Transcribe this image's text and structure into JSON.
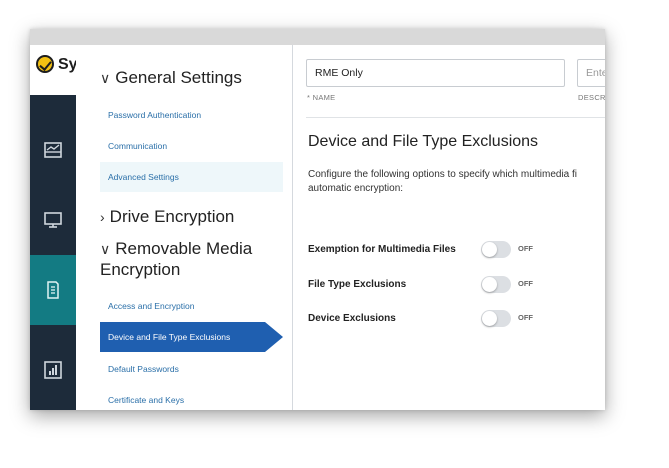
{
  "app": {
    "logo_text": "Sy"
  },
  "rail": {
    "items": [
      "dashboard-icon",
      "devices-icon",
      "policies-icon",
      "reports-icon"
    ],
    "active_index": 2
  },
  "nav": {
    "general_settings": "General Settings",
    "general_items": [
      "Password Authentication",
      "Communication",
      "Advanced Settings"
    ],
    "drive_encryption": "Drive Encryption",
    "removable_media_line1": "Removable Media",
    "removable_media_line2": "Encryption",
    "removable_items": [
      "Access and Encryption",
      "Device and File Type Exclusions",
      "Default Passwords",
      "Certificate and Keys"
    ]
  },
  "form": {
    "name_value": "RME Only",
    "name_label": "* NAME",
    "description_placeholder": "Ente",
    "description_label": "DESCR"
  },
  "section": {
    "title": "Device and File Type Exclusions",
    "desc_line1": "Configure the following options to specify which multimedia fi",
    "desc_line2": "automatic encryption:",
    "options": [
      {
        "label": "Exemption for Multimedia Files",
        "state": "OFF"
      },
      {
        "label": "File Type Exclusions",
        "state": "OFF"
      },
      {
        "label": "Device Exclusions",
        "state": "OFF"
      }
    ]
  },
  "colors": {
    "rail": "#1d2b3a",
    "rail_active": "#137b83",
    "selected_nav": "#1f5fb0",
    "link": "#2a6fa8"
  }
}
